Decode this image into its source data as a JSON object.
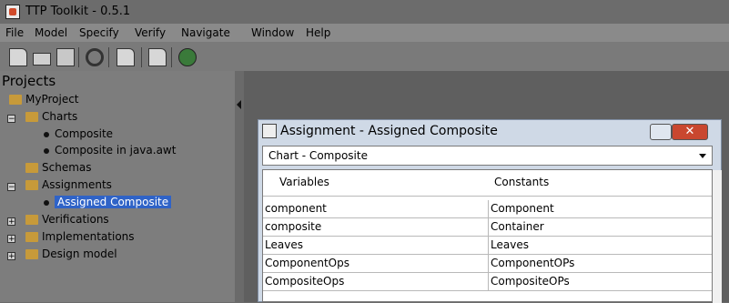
{
  "window": {
    "title": "TTP Toolkit - 0.5.1",
    "icon": "java-icon"
  },
  "menu": [
    "File",
    "Model",
    "Specify",
    "Verify",
    "Navigate",
    "Window",
    "Help"
  ],
  "toolbar": [
    {
      "name": "new-document-icon"
    },
    {
      "name": "open-folder-icon"
    },
    {
      "name": "save-icon"
    },
    {
      "name": "refresh-icon"
    },
    {
      "name": "add-document-icon"
    },
    {
      "name": "next-document-icon"
    },
    {
      "name": "verify-globe-icon"
    }
  ],
  "sidebar": {
    "title": "Projects",
    "tree": [
      {
        "label": "MyProject",
        "type": "folder"
      },
      {
        "label": "Charts",
        "type": "folder",
        "expander": "−"
      },
      {
        "label": "Composite",
        "type": "leaf"
      },
      {
        "label": "Composite in java.awt",
        "type": "leaf"
      },
      {
        "label": "Schemas",
        "type": "folder"
      },
      {
        "label": "Assignments",
        "type": "folder",
        "expander": "−"
      },
      {
        "label": "Assigned Composite",
        "type": "leaf",
        "selected": true
      },
      {
        "label": "Verifications",
        "type": "folder",
        "expander": "+"
      },
      {
        "label": "Implementations",
        "type": "folder",
        "expander": "+"
      },
      {
        "label": "Design model",
        "type": "folder",
        "expander": "+"
      }
    ]
  },
  "dialog": {
    "title": "Assignment - Assigned Composite",
    "chart_select": "Chart - Composite",
    "columns": [
      "Variables",
      "Constants"
    ],
    "rows": [
      [
        "component",
        "Component"
      ],
      [
        "composite",
        "Container"
      ],
      [
        "Leaves",
        "Leaves"
      ],
      [
        "ComponentOps",
        "ComponentOPs"
      ],
      [
        "CompositeOps",
        "CompositeOPs"
      ]
    ],
    "close_label": "✕"
  }
}
